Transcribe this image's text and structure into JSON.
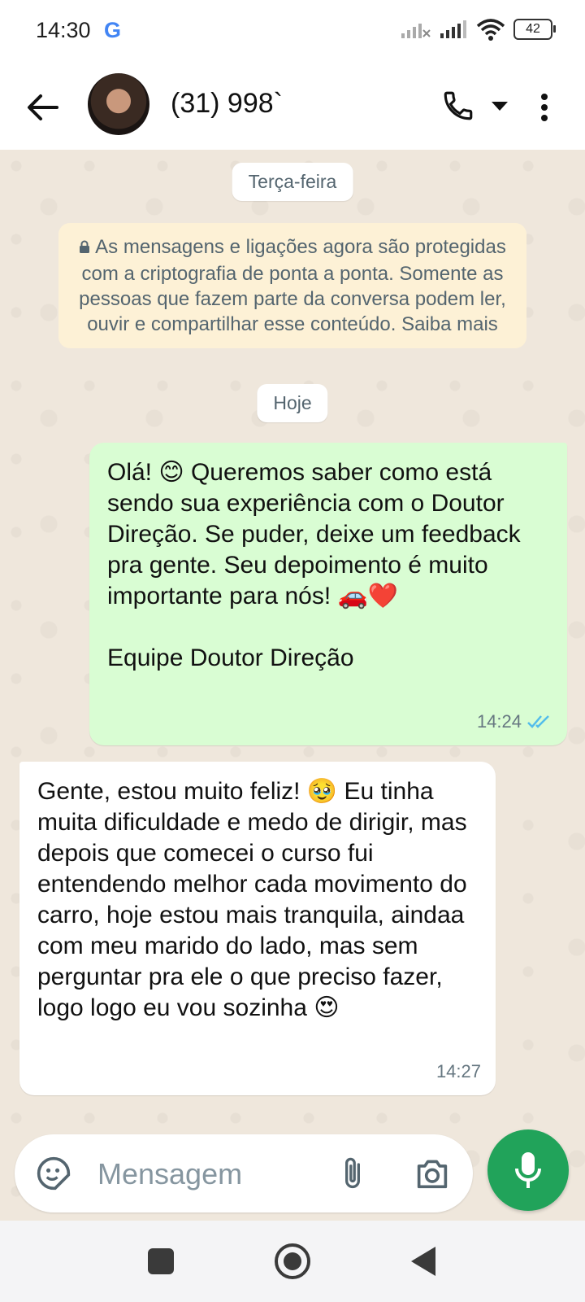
{
  "status_bar": {
    "time": "14:30",
    "google_icon": "G",
    "battery": "42"
  },
  "header": {
    "contact": "(31) 998`",
    "icons": [
      "back-arrow-icon",
      "phone-icon",
      "dropdown-arrow-icon",
      "more-vert-icon"
    ]
  },
  "chat": {
    "date_1": "Terça-feira",
    "encryption_notice": "As mensagens e ligações agora são protegidas com a criptografia de ponta a ponta. Somente as pessoas que fazem parte da conversa podem ler, ouvir e compartilhar esse conteúdo. Saiba mais",
    "date_2": "Hoje",
    "messages": [
      {
        "direction": "outgoing",
        "text": "Olá! 😊 Queremos saber como está sendo sua experiência com o Doutor Direção. Se puder, deixe um feedback pra gente. Seu depoimento é muito importante para nós! 🚗❤️\n\nEquipe Doutor Direção",
        "time": "14:24",
        "status": "read"
      },
      {
        "direction": "incoming",
        "text": "Gente, estou muito feliz! 🥹 Eu tinha muita dificuldade e medo de dirigir, mas depois que comecei o curso fui entendendo melhor cada movimento do carro, hoje estou mais tranquila, aindaa com meu marido do lado, mas sem perguntar pra ele o que preciso fazer, logo logo eu vou sozinha 😍",
        "time": "14:27"
      }
    ]
  },
  "composer": {
    "placeholder": "Mensagem"
  },
  "colors": {
    "outgoing_bubble": "#d9fdd3",
    "incoming_bubble": "#ffffff",
    "notice_bg": "#fdf1d6",
    "mic_button": "#21a35a",
    "read_ticks": "#53bdeb"
  }
}
